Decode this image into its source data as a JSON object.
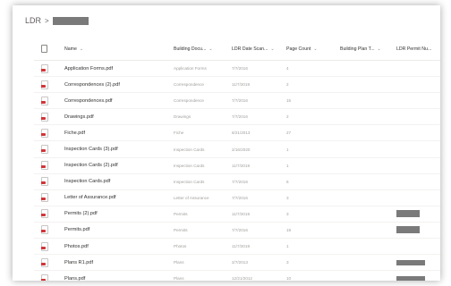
{
  "breadcrumb": {
    "root": "LDR",
    "separator": ">"
  },
  "columns": {
    "name": "Name",
    "building_document_type": "Building Docu...",
    "ldr_date_scanned": "LDR Date Scan...",
    "page_count": "Page Count",
    "building_plan_type": "Building Plan T...",
    "ldr_permit_number": "LDR Permit Nu..."
  },
  "rows": [
    {
      "name": "Application Forms.pdf",
      "type": "Application Forms",
      "date": "7/7/2016",
      "pages": "4",
      "permit_redacted": false
    },
    {
      "name": "Correspondences (2).pdf",
      "type": "Correspondence",
      "date": "11/7/2019",
      "pages": "2",
      "permit_redacted": false
    },
    {
      "name": "Correspondences.pdf",
      "type": "Correspondence",
      "date": "7/7/2016",
      "pages": "15",
      "permit_redacted": false
    },
    {
      "name": "Drawings.pdf",
      "type": "Drawings",
      "date": "7/7/2016",
      "pages": "2",
      "permit_redacted": false
    },
    {
      "name": "Fiche.pdf",
      "type": "Fiche",
      "date": "6/21/2013",
      "pages": "27",
      "permit_redacted": false
    },
    {
      "name": "Inspection Cards (3).pdf",
      "type": "Inspection Cards",
      "date": "2/16/2020",
      "pages": "1",
      "permit_redacted": false
    },
    {
      "name": "Inspection Cards (2).pdf",
      "type": "Inspection Cards",
      "date": "11/7/2019",
      "pages": "1",
      "permit_redacted": false
    },
    {
      "name": "Inspection Cards.pdf",
      "type": "Inspection Cards",
      "date": "7/7/2016",
      "pages": "6",
      "permit_redacted": false
    },
    {
      "name": "Letter of Assurance.pdf",
      "type": "Letter of Assurance",
      "date": "7/7/2016",
      "pages": "3",
      "permit_redacted": false
    },
    {
      "name": "Permits (2).pdf",
      "type": "Permits",
      "date": "11/7/2019",
      "pages": "3",
      "permit_redacted": true
    },
    {
      "name": "Permits.pdf",
      "type": "Permits",
      "date": "7/7/2016",
      "pages": "19",
      "permit_redacted": true
    },
    {
      "name": "Photos.pdf",
      "type": "Photos",
      "date": "11/7/2019",
      "pages": "1",
      "permit_redacted": false
    },
    {
      "name": "Plans R1.pdf",
      "type": "Plans",
      "date": "2/7/2013",
      "pages": "3",
      "permit_redacted": true
    },
    {
      "name": "Plans.pdf",
      "type": "Plans",
      "date": "12/21/2012",
      "pages": "10",
      "permit_redacted": true
    }
  ],
  "colors": {
    "pdf_icon": "#d13438",
    "redaction": "#7a7a7a"
  }
}
